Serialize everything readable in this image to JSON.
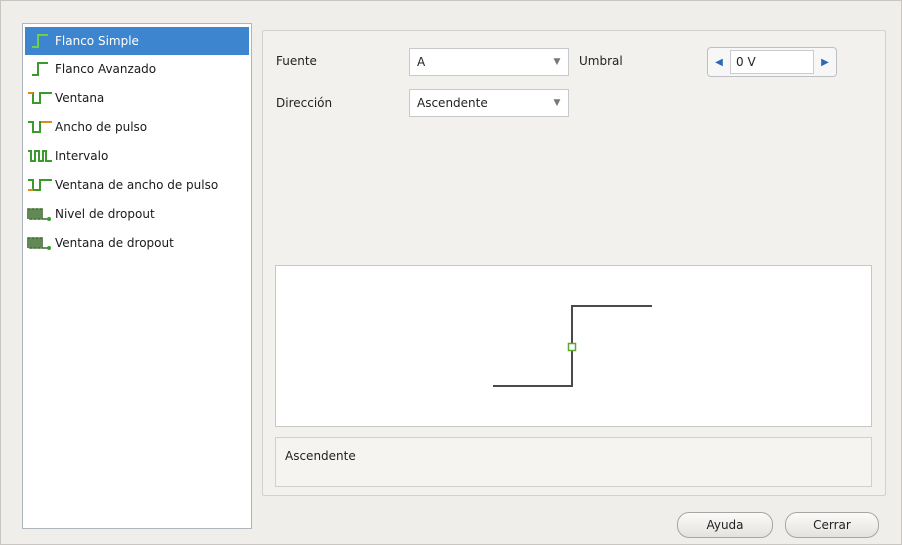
{
  "trigger_list": {
    "items": [
      {
        "label": "Flanco Simple",
        "icon": "simple-edge-icon",
        "selected": true
      },
      {
        "label": "Flanco Avanzado",
        "icon": "advanced-edge-icon",
        "selected": false
      },
      {
        "label": "Ventana",
        "icon": "window-icon",
        "selected": false
      },
      {
        "label": "Ancho de pulso",
        "icon": "pulse-width-icon",
        "selected": false
      },
      {
        "label": "Intervalo",
        "icon": "interval-icon",
        "selected": false
      },
      {
        "label": "Ventana de ancho de pulso",
        "icon": "window-pulse-width-icon",
        "selected": false
      },
      {
        "label": "Nivel de dropout",
        "icon": "level-dropout-icon",
        "selected": false
      },
      {
        "label": "Ventana de dropout",
        "icon": "window-dropout-icon",
        "selected": false
      }
    ]
  },
  "settings": {
    "source_label": "Fuente",
    "source_value": "A",
    "threshold_label": "Umbral",
    "threshold_value": "0 V",
    "direction_label": "Dirección",
    "direction_value": "Ascendente"
  },
  "description": "Ascendente",
  "buttons": {
    "help": "Ayuda",
    "close": "Cerrar"
  },
  "colors": {
    "selection": "#3d86cf",
    "waveform": "#4a4a4a",
    "trigger_marker": "#5aa832",
    "icon_green": "#3a9b2c",
    "icon_orange": "#e08a1e"
  }
}
